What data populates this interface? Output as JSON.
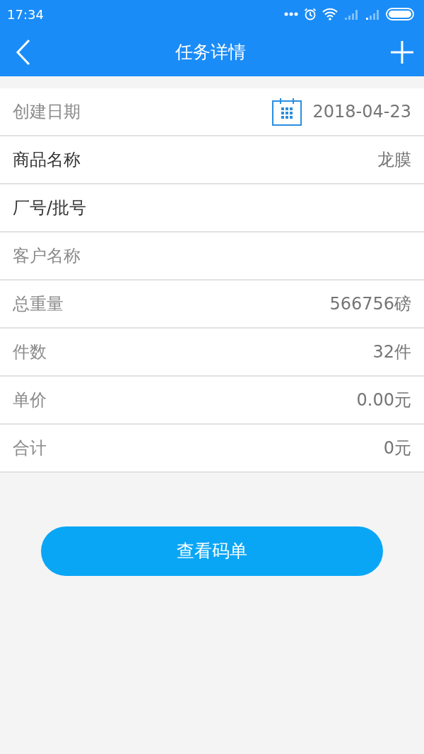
{
  "status_bar": {
    "time": "17:34"
  },
  "header": {
    "title": "任务详情"
  },
  "rows": [
    {
      "kind": "date",
      "label": "创建日期",
      "value": "2018-04-23",
      "editable": false
    },
    {
      "kind": "text",
      "label": "商品名称",
      "value": "龙膜",
      "editable": true
    },
    {
      "kind": "text",
      "label": "厂号/批号",
      "editable": true
    },
    {
      "kind": "text",
      "label": "客户名称",
      "editable": false
    },
    {
      "kind": "text",
      "label": "总重量",
      "value": "566756磅",
      "editable": false
    },
    {
      "kind": "text",
      "label": "件数",
      "value": "32件",
      "editable": false
    },
    {
      "kind": "text",
      "label": "单价",
      "value": "0.00元",
      "editable": false
    },
    {
      "kind": "text",
      "label": "合计",
      "value": "0元",
      "editable": false
    }
  ],
  "action_button": {
    "label": "查看码单"
  }
}
